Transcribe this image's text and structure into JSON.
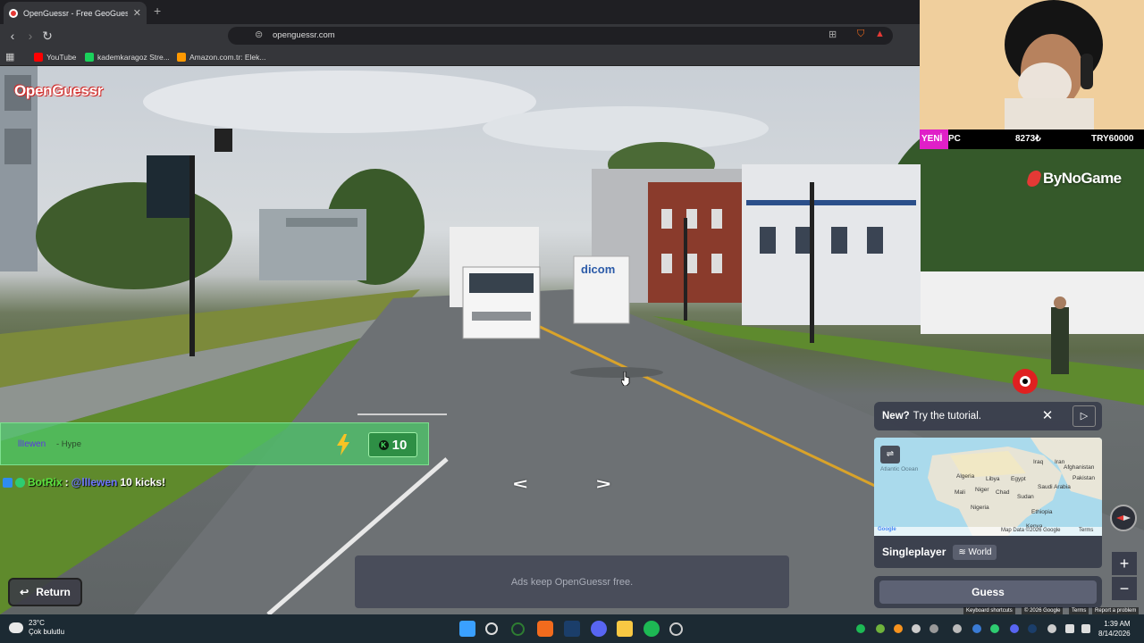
{
  "browser": {
    "tab_title": "OpenGuessr - Free GeoGuess",
    "tab_close": "✕",
    "new_tab": "+",
    "url": "openguessr.com",
    "bookmarks": [
      {
        "label": "YouTube",
        "color": "#ff0000"
      },
      {
        "label": "kademkaragoz Stre...",
        "color": "#1ad15b"
      },
      {
        "label": "Amazon.com.tr: Elek...",
        "color": "#ff9900"
      }
    ]
  },
  "game": {
    "logo": "OpenGuessr",
    "return_label": "Return",
    "ads_text": "Ads keep OpenGuessr free.",
    "tutorial_new": "New?",
    "tutorial_text": "Try the tutorial.",
    "mode_title": "Singleplayer",
    "mode_chip": "World",
    "guess_label": "Guess",
    "zoom_in": "+",
    "zoom_out": "−",
    "arrow_left": "<",
    "arrow_right": ">",
    "map_labels": [
      "Atlantic Ocean",
      "Algeria",
      "Libya",
      "Egypt",
      "Iraq",
      "Iran",
      "Afghanistan",
      "Pakistan",
      "Mali",
      "Niger",
      "Chad",
      "Sudan",
      "Nigeria",
      "Ethiopia",
      "Kenya",
      "Saudi Arabia",
      "Google",
      "Map Data ©2026 Google",
      "Terms"
    ],
    "footer_links": [
      "Keyboard shortcuts",
      "© 2026 Google",
      "Terms",
      "Report a problem"
    ]
  },
  "stream": {
    "donation_new": "YENİ",
    "donation_pc": "PC",
    "donation_amount": "8273₺",
    "donation_goal": "TRY60000",
    "sponsor": "ByNoGame",
    "alert_user": "llIewen",
    "alert_msg": "- Hype",
    "alert_count": "10",
    "chat_user": "BotRix",
    "chat_sep": ":",
    "chat_mention": "@llIewen",
    "chat_msg": "10 kicks!"
  },
  "taskbar": {
    "temperature": "23°C",
    "weather": "Çok bulutlu",
    "time": "1:39 AM",
    "date": "8/14/2026"
  },
  "colors": {
    "accent_red": "#e53935",
    "alert_green": "#4cc768",
    "chat_user_green": "#59e33f",
    "mention_blue": "#6d75ff",
    "donation_pink": "#e01fc8"
  }
}
